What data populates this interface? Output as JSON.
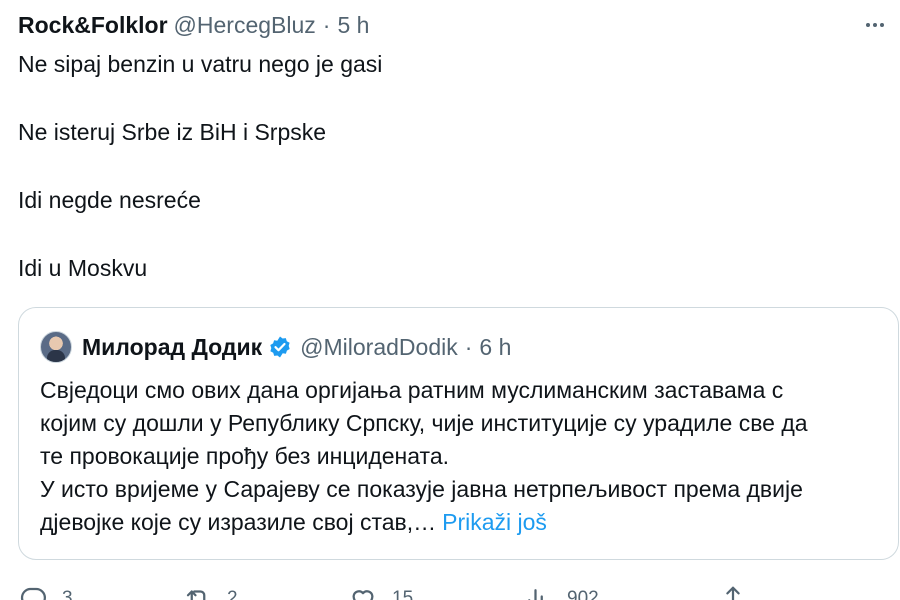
{
  "tweet": {
    "author_name": "Rock&Folklor",
    "handle": "@HercegBluz",
    "separator": "·",
    "time": "5 h",
    "text_lines": [
      "Ne sipaj benzin u vatru nego je gasi",
      "Ne isteruj Srbe iz BiH i Srpske",
      "Idi negde nesreće",
      "Idi u Moskvu"
    ]
  },
  "quote": {
    "author_name": "Милорад Додик",
    "handle": "@MiloradDodik",
    "separator": "·",
    "time": "6 h",
    "text_lines": [
      "Свједоци смо ових дана оргијања ратним муслиманским заставама с",
      "којим су дошли у Републику Српску, чије институције су урадиле све да",
      "те провокације прођу без инцидената.",
      "У исто вријеме у Сарајеву се показује јавна нетрпељивост према двије",
      "дјевојке које су изразиле свој став,…"
    ],
    "show_more_label": "Prikaži još",
    "verified_color": "#1d9bf0"
  },
  "actions": {
    "reply_count": "3",
    "retweet_count": "2",
    "like_count": "15",
    "views_count": "902"
  },
  "icons": {
    "more": "more-icon",
    "verified": "verified-badge-icon",
    "reply": "reply-icon",
    "retweet": "retweet-icon",
    "like": "heart-icon",
    "views": "views-chart-icon",
    "share": "share-icon"
  },
  "colors": {
    "text": "#0f1419",
    "secondary": "#536471",
    "link": "#1d9bf0",
    "border": "#cfd9de"
  }
}
